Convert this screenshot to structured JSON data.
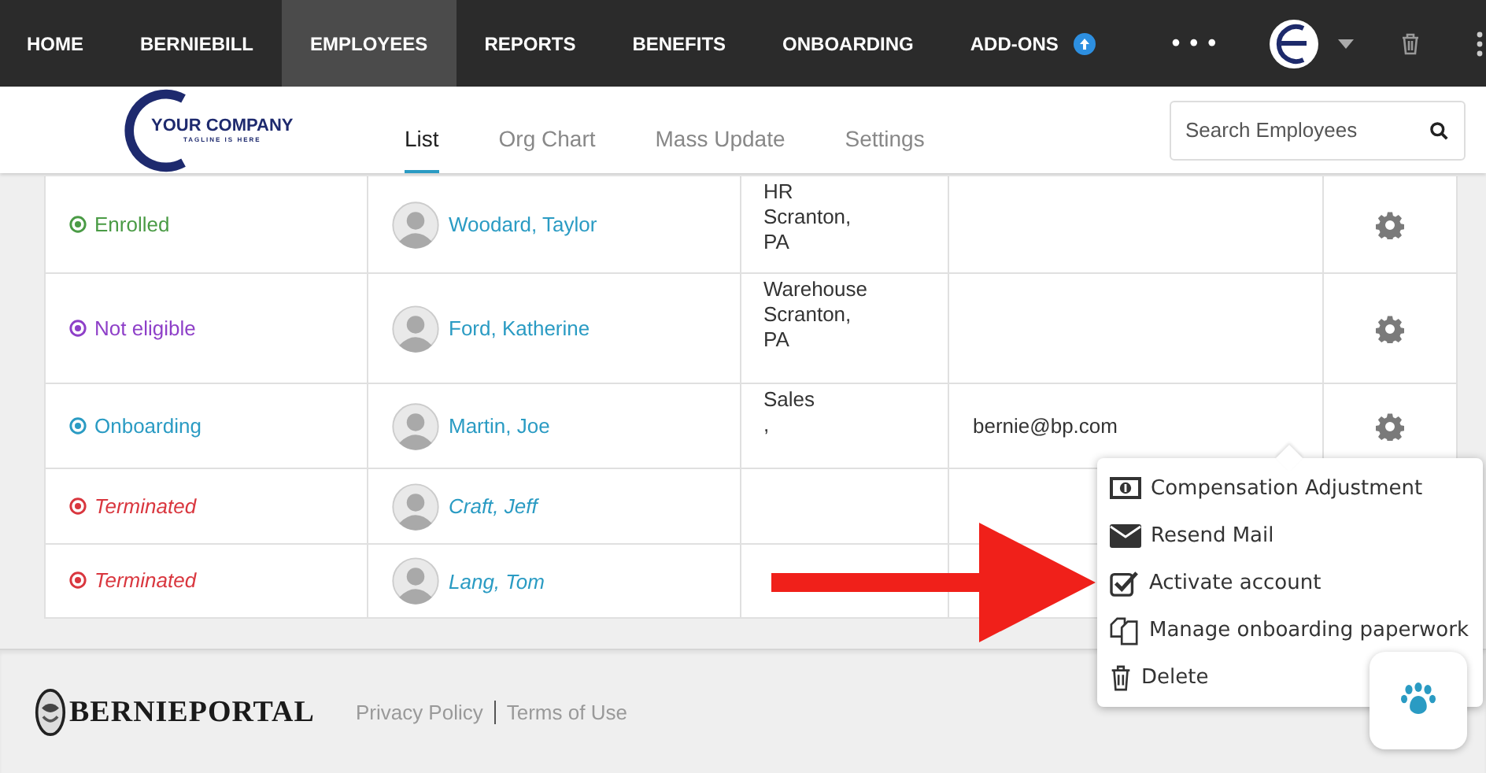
{
  "nav": {
    "items": [
      {
        "label": "HOME",
        "selected": false,
        "badge": false
      },
      {
        "label": "BERNIEBILL",
        "selected": false,
        "badge": false
      },
      {
        "label": "EMPLOYEES",
        "selected": true,
        "badge": false
      },
      {
        "label": "REPORTS",
        "selected": false,
        "badge": false
      },
      {
        "label": "BENEFITS",
        "selected": false,
        "badge": false
      },
      {
        "label": "ONBOARDING",
        "selected": false,
        "badge": false
      },
      {
        "label": "ADD-ONS",
        "selected": false,
        "badge": true
      }
    ],
    "more": "• • •"
  },
  "company_logo": {
    "name": "YOUR COMPANY",
    "tagline": "TAGLINE IS HERE"
  },
  "tabs": [
    {
      "label": "List",
      "selected": true
    },
    {
      "label": "Org Chart",
      "selected": false
    },
    {
      "label": "Mass Update",
      "selected": false
    },
    {
      "label": "Settings",
      "selected": false
    }
  ],
  "search": {
    "placeholder": "Search Employees"
  },
  "rows": [
    {
      "status": "Enrolled",
      "color": "#4a9b45",
      "terminated": false,
      "name": "Woodard, Taylor",
      "department": "HR",
      "location": "Scranton, PA"
    },
    {
      "status": "Not eligible",
      "color": "#8e3fc8",
      "terminated": false,
      "name": "Ford, Katherine",
      "department": "Warehouse",
      "location": "Scranton, PA"
    },
    {
      "status": "Onboarding",
      "color": "#2a9bc3",
      "terminated": false,
      "name": "Martin, Joe",
      "department": "Sales",
      "location": ",",
      "email": "bernie@bp.com"
    },
    {
      "status": "Terminated",
      "color": "#d9363e",
      "terminated": true,
      "name": "Craft, Jeff"
    },
    {
      "status": "Terminated",
      "color": "#d9363e",
      "terminated": true,
      "name": "Lang, Tom"
    }
  ],
  "menu": [
    {
      "kind": "money",
      "label": "Compensation Adjustment"
    },
    {
      "kind": "mail",
      "label": "Resend Mail"
    },
    {
      "kind": "check",
      "label": "Activate account"
    },
    {
      "kind": "copy",
      "label": "Manage onboarding paperwork"
    },
    {
      "kind": "trash",
      "label": "Delete"
    }
  ],
  "footer": {
    "logo": "BERNIEPORTAL",
    "links": [
      "Privacy Policy",
      "Terms of Use"
    ]
  }
}
